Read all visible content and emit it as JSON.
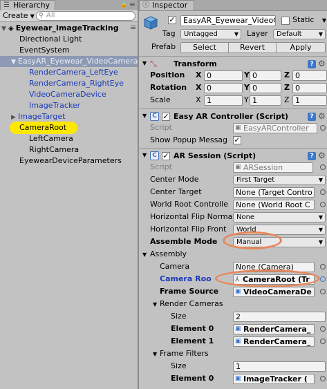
{
  "hierarchy": {
    "tab_label": "Hierarchy",
    "create_label": "Create",
    "search_placeholder": "All",
    "scene_name": "Eyewear_ImageTracking",
    "items": [
      {
        "label": "Directional Light"
      },
      {
        "label": "EventSystem"
      },
      {
        "label": "EasyAR_Eyewear_VideoCamera"
      },
      {
        "label": "RenderCamera_LeftEye"
      },
      {
        "label": "RenderCamera_RightEye"
      },
      {
        "label": "VideoCameraDevice"
      },
      {
        "label": "ImageTracker"
      },
      {
        "label": "ImageTarget"
      },
      {
        "label": "CameraRoot"
      },
      {
        "label": "LeftCamera"
      },
      {
        "label": "RightCamera"
      },
      {
        "label": "EyewearDeviceParameters"
      }
    ]
  },
  "inspector": {
    "tab_label": "Inspector",
    "object_name": "EasyAR_Eyewear_VideoCamera",
    "static_label": "Static",
    "tag_label": "Tag",
    "tag_value": "Untagged",
    "layer_label": "Layer",
    "layer_value": "Default",
    "prefab_label": "Prefab",
    "prefab_buttons": [
      "Select",
      "Revert",
      "Apply"
    ],
    "transform": {
      "title": "Transform",
      "rows": [
        {
          "label": "Position",
          "x": "0",
          "y": "0",
          "z": "0"
        },
        {
          "label": "Rotation",
          "x": "0",
          "y": "0",
          "z": "0"
        },
        {
          "label": "Scale",
          "x": "1",
          "y": "1",
          "z": "1"
        }
      ],
      "axis_x": "X",
      "axis_y": "Y",
      "axis_z": "Z"
    },
    "easyar_controller": {
      "title": "Easy AR Controller (Script)",
      "script_label": "Script",
      "script_value": "EasyARController",
      "show_popup_label": "Show Popup Messag"
    },
    "ar_session": {
      "title": "AR Session (Script)",
      "script_label": "Script",
      "script_value": "ARSession",
      "center_mode_label": "Center Mode",
      "center_mode_value": "First Target",
      "center_target_label": "Center Target",
      "center_target_value": "None (Target Contro",
      "world_root_label": "World Root Controlle",
      "world_root_value": "None (World Root C",
      "hflip_normal_label": "Horizontal Flip Norma",
      "hflip_normal_value": "None",
      "hflip_front_label": "Horizontal Flip Front",
      "hflip_front_value": "World",
      "assemble_mode_label": "Assemble Mode",
      "assemble_mode_value": "Manual",
      "assembly_label": "Assembly",
      "camera_label": "Camera",
      "camera_value": "None (Camera)",
      "camera_root_label": "Camera Roo",
      "camera_root_value": "CameraRoot (Tr",
      "frame_source_label": "Frame Source",
      "frame_source_value": "VideoCameraDe",
      "render_cameras_label": "Render Cameras",
      "rc_size_label": "Size",
      "rc_size_value": "2",
      "rc_element0_label": "Element 0",
      "rc_element0_value": "RenderCamera_",
      "rc_element1_label": "Element 1",
      "rc_element1_value": "RenderCamera_",
      "frame_filters_label": "Frame Filters",
      "ff_size_label": "Size",
      "ff_size_value": "1",
      "ff_element0_label": "Element 0",
      "ff_element0_value": "ImageTracker ("
    }
  },
  "colors": {
    "highlight_yellow": "#ffe800",
    "annotation_orange": "#e8875a",
    "selection_blue": "#8e9ab4",
    "prefab_blue": "#1a3ab8"
  }
}
